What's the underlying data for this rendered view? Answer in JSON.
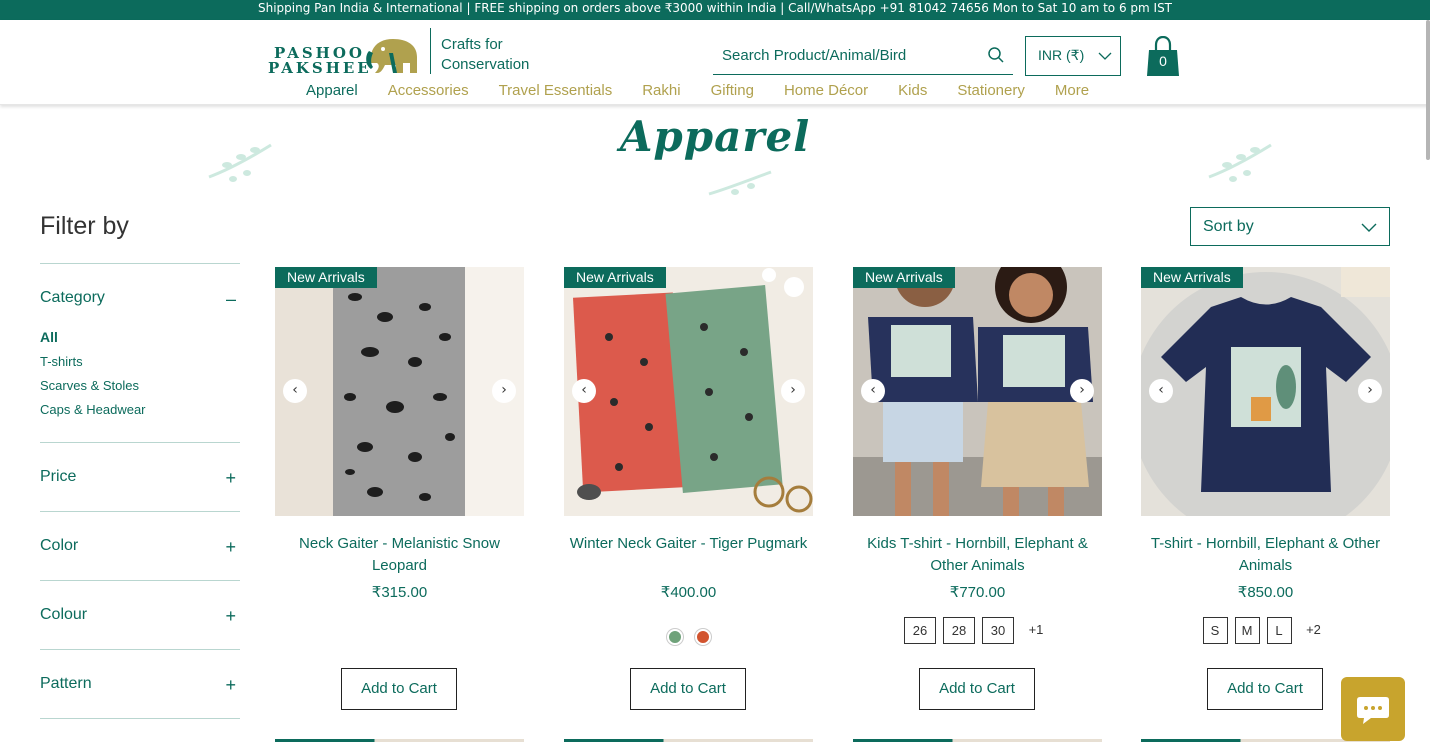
{
  "topbar": {
    "text": "Shipping Pan India & International | FREE shipping on orders above ₹3000 within India | Call/WhatsApp +91 81042 74656 Mon to Sat 10 am to 6 pm IST"
  },
  "brand": {
    "line1": "PASHOO",
    "line2": "PAKSHEE",
    "tagline1": "Crafts for",
    "tagline2": "Conservation"
  },
  "search": {
    "placeholder": "Search Product/Animal/Bird"
  },
  "currency": {
    "value": "INR (₹)"
  },
  "cart": {
    "count": "0"
  },
  "nav": {
    "items": [
      "Apparel",
      "Accessories",
      "Travel Essentials",
      "Rakhi",
      "Gifting",
      "Home Décor",
      "Kids",
      "Stationery",
      "More"
    ]
  },
  "page": {
    "title": "Apparel"
  },
  "filters": {
    "title": "Filter by",
    "category": {
      "label": "Category",
      "items": [
        "All",
        "T-shirts",
        "Scarves & Stoles",
        "Caps & Headwear"
      ]
    },
    "price": "Price",
    "color": "Color",
    "colour": "Colour",
    "pattern": "Pattern",
    "expand_symbol": "+",
    "collapse_symbol": "–"
  },
  "sort": {
    "label": "Sort by"
  },
  "products": [
    {
      "badge": "New Arrivals",
      "name": "Neck Gaiter - Melanistic Snow Leopard",
      "price": "₹315.00",
      "button": "Add to Cart"
    },
    {
      "badge": "New Arrivals",
      "name": "Winter Neck Gaiter - Tiger Pugmark",
      "price": "₹400.00",
      "button": "Add to Cart",
      "swatches": [
        "#6fa27a",
        "#d2542f"
      ]
    },
    {
      "badge": "New Arrivals",
      "name": "Kids T-shirt - Hornbill, Elephant & Other Animals",
      "price": "₹770.00",
      "button": "Add to Cart",
      "sizes": [
        "26",
        "28",
        "30"
      ],
      "more": "+1"
    },
    {
      "badge": "New Arrivals",
      "name": "T-shirt - Hornbill, Elephant & Other Animals",
      "price": "₹850.00",
      "button": "Add to Cart",
      "sizes": [
        "S",
        "M",
        "L"
      ],
      "more": "+2"
    }
  ],
  "colors": {
    "brand_green": "#0c6b5c",
    "nav_gold": "#b0a14e",
    "chat_bg": "#c8a42d"
  }
}
